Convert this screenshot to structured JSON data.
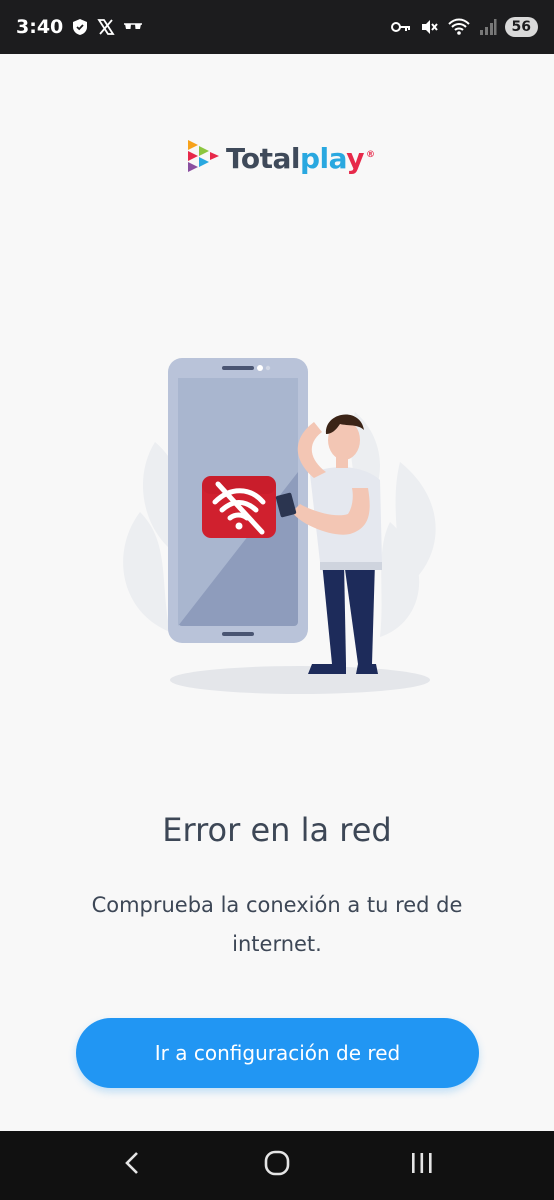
{
  "status_bar": {
    "time": "3:40",
    "battery": "56",
    "left_icons": [
      "shield-icon",
      "x-logo-icon",
      "glasses-icon"
    ],
    "right_icons": [
      "key-icon",
      "mute-icon",
      "wifi-icon",
      "signal-icon"
    ]
  },
  "brand": {
    "name_part1": "Total",
    "name_part2": "pla",
    "name_part3": "y",
    "registered": "®",
    "colors": {
      "dark": "#3f4a5a",
      "blue": "#29a8e0",
      "red": "#e7294a",
      "orange": "#f7a21b",
      "green": "#8cc63f",
      "purple": "#8a4fa0"
    }
  },
  "illustration": {
    "icon": "no-wifi-icon",
    "accent": "#d0202e"
  },
  "error": {
    "title": "Error en la red",
    "message": "Comprueba la conexión a tu red de internet."
  },
  "actions": {
    "network_settings_label": "Ir a configuración de red",
    "button_color": "#2196f3"
  },
  "nav": {
    "icons": [
      "back-icon",
      "home-icon",
      "recents-icon"
    ]
  }
}
